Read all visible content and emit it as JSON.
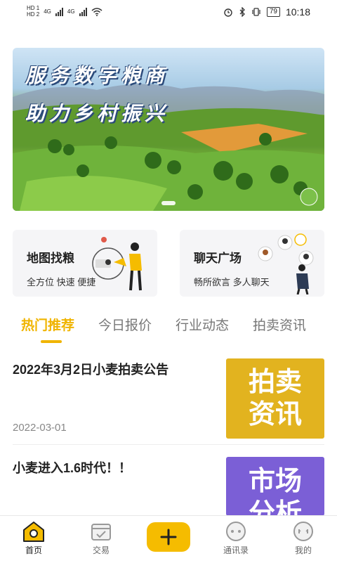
{
  "status_bar": {
    "sim1": "HD 1",
    "sim2": "HD 2",
    "net1": "4G",
    "net2": "4G",
    "battery": "79",
    "time": "10:18"
  },
  "banner": {
    "line1": "服务数字粮商",
    "line2": "助力乡村振兴"
  },
  "features": [
    {
      "title": "地图找粮",
      "subtitle": "全方位 快速 便捷"
    },
    {
      "title": "聊天广场",
      "subtitle": "畅所欲言 多人聊天"
    }
  ],
  "tabs": [
    "热门推荐",
    "今日报价",
    "行业动态",
    "拍卖资讯"
  ],
  "active_tab": 0,
  "news": [
    {
      "title": "2022年3月2日小麦拍卖公告",
      "date": "2022-03-01",
      "thumb_line1": "拍卖",
      "thumb_line2": "资讯",
      "thumb_color": "#e2b31f"
    },
    {
      "title": "小麦进入1.6时代！！",
      "date": "",
      "thumb_line1": "市场",
      "thumb_line2": "分析",
      "thumb_color": "#7b5fd6"
    }
  ],
  "bottom_nav": [
    {
      "label": "首页",
      "icon": "home-icon",
      "active": true
    },
    {
      "label": "交易",
      "icon": "trade-icon",
      "active": false
    },
    {
      "label": "",
      "icon": "plus-icon",
      "active": false
    },
    {
      "label": "通讯录",
      "icon": "contacts-icon",
      "active": false
    },
    {
      "label": "我的",
      "icon": "profile-icon",
      "active": false
    }
  ],
  "colors": {
    "accent": "#f0b400",
    "thumb_auction": "#e2b31f",
    "thumb_market": "#7b5fd6"
  }
}
